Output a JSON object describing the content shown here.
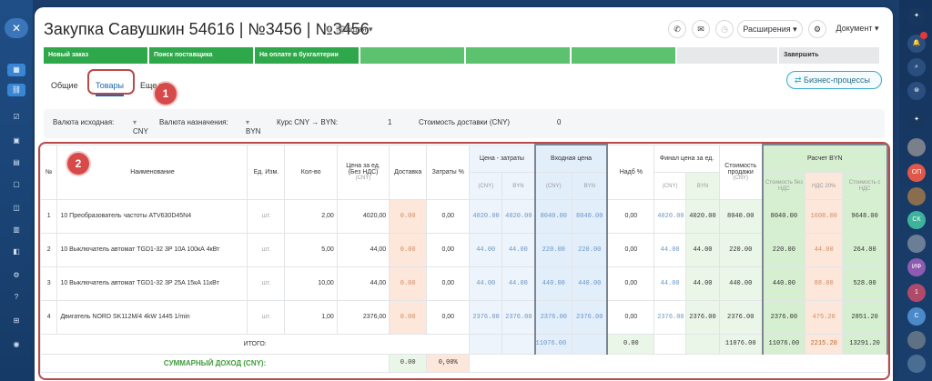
{
  "sidebar_left": {
    "close": "✕"
  },
  "sidebar_right": {
    "avatars": [
      "ОП",
      "СК",
      "ИФ",
      "1",
      "С"
    ]
  },
  "header": {
    "title": "Закупка Савушкин 54616 | №3456 | №3456",
    "category": "Общая",
    "extensions_label": "Расширения",
    "document_label": "Документ"
  },
  "stages": [
    "Новый заказ",
    "Поиск поставщика",
    "На оплате в бухгалтерии",
    "",
    "",
    "",
    "",
    "Завершить"
  ],
  "tabs": {
    "general": "Общие",
    "goods": "Товары",
    "more": "Еще"
  },
  "callouts": [
    "1",
    "2"
  ],
  "business_process_label": "Бизнес-процессы",
  "params": {
    "source_currency_label": "Валюта исходная:",
    "source_currency_value": "CNY",
    "target_currency_label": "Валюта назначения:",
    "target_currency_value": "BYN",
    "rate_label": "Курс CNY → BYN:",
    "rate_value": "1",
    "delivery_cost_label": "Стоимость доставки (CNY)",
    "delivery_cost_value": "0"
  },
  "table": {
    "headers": {
      "num": "№",
      "name": "Наименование",
      "unit": "Ед. Изм.",
      "qty": "Кол-во",
      "price": "Цена за ед. (Без НДС)",
      "price_sub": "(CNY)",
      "delivery": "Доставка",
      "costs_pct": "Затраты %",
      "price_costs": "Цена - затраты",
      "input_price": "Входная цена",
      "markup": "Надб %",
      "final_price": "Финал цена за ед.",
      "sale_cost": "Стоимость продажи",
      "sale_cost_sub": "(CNY)",
      "calc_byn": "Расчет BYN",
      "cost_no_vat": "Стоимость без НДС",
      "vat": "НДС 20%",
      "cost_vat": "Стоимость с НДС",
      "cny": "(CNY)",
      "byn": "BYN"
    },
    "rows": [
      {
        "n": "1",
        "name": "10 Преобразователь частоты ATV630D45N4",
        "unit": "шт.",
        "qty": "2,00",
        "price": "4020,00",
        "delivery": "0.00",
        "costs": "0,00",
        "pc_cny": "4020.00",
        "pc_byn": "4020.00",
        "in_cny": "8040.00",
        "in_byn": "8040.00",
        "markup": "0,00",
        "fin_cny": "4020.00",
        "fin_byn": "4020.00",
        "sale": "8040.00",
        "no_vat": "8040.00",
        "vat": "1608.00",
        "with_vat": "9648.00"
      },
      {
        "n": "2",
        "name": "10 Выключатель автомат TGD1-32 3P 10A 100кА 4кВт",
        "unit": "шт.",
        "qty": "5,00",
        "price": "44,00",
        "delivery": "0.00",
        "costs": "0,00",
        "pc_cny": "44.00",
        "pc_byn": "44.00",
        "in_cny": "220.00",
        "in_byn": "220.00",
        "markup": "0,00",
        "fin_cny": "44.00",
        "fin_byn": "44.00",
        "sale": "220.00",
        "no_vat": "220.00",
        "vat": "44.00",
        "with_vat": "264.00"
      },
      {
        "n": "3",
        "name": "10 Выключатель автомат TGD1-32 3P 25A 15кА 11кВт",
        "unit": "шт.",
        "qty": "10,00",
        "price": "44,00",
        "delivery": "0.00",
        "costs": "0,00",
        "pc_cny": "44.00",
        "pc_byn": "44.00",
        "in_cny": "440.00",
        "in_byn": "440.00",
        "markup": "0,00",
        "fin_cny": "44.00",
        "fin_byn": "44.00",
        "sale": "440.00",
        "no_vat": "440.00",
        "vat": "88.00",
        "with_vat": "528.00"
      },
      {
        "n": "4",
        "name": "Двигатель NORD SK112M/4 4kW 1445 1/min",
        "unit": "шт.",
        "qty": "1,00",
        "price": "2376,00",
        "delivery": "0.00",
        "costs": "0,00",
        "pc_cny": "2376.00",
        "pc_byn": "2376.00",
        "in_cny": "2376.00",
        "in_byn": "2376.00",
        "markup": "0,00",
        "fin_cny": "2376.00",
        "fin_byn": "2376.00",
        "sale": "2376.00",
        "no_vat": "2376.00",
        "vat": "475.20",
        "with_vat": "2851.20"
      }
    ],
    "total": {
      "label": "ИТОГО:",
      "input": "11076.00",
      "markup": "0.00",
      "sale": "11076.00",
      "no_vat": "11076.00",
      "vat": "2215.20",
      "with_vat": "13291.20"
    },
    "summary": {
      "label": "СУММАРНЫЙ ДОХОД (CNY):",
      "value": "0.00",
      "pct": "0,00%"
    }
  },
  "colors": {
    "stage_green": "#2ea84a",
    "accent": "#2067b0",
    "highlight": "#b84a4a"
  }
}
